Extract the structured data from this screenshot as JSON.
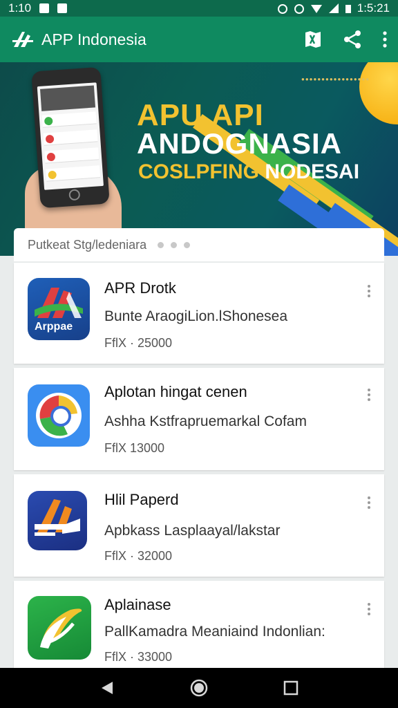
{
  "status_bar": {
    "time": "1:10",
    "clock_right": "1:5:21"
  },
  "app_bar": {
    "title": "APP Indonesia",
    "icons": [
      "logo-icon",
      "map-icon",
      "share-icon",
      "more-vert-icon"
    ]
  },
  "banner": {
    "headline_line1": "APU API",
    "headline_line2": "ANDOGNASIA",
    "headline_line3_yellow": "COSLPFING",
    "headline_line3_white": "NODESAI",
    "tagline": "●●●●●●●●●●●●●●●●●"
  },
  "search": {
    "placeholder": "Putkeat Stg/ledeniara"
  },
  "apps": [
    {
      "name": "APR Drotk",
      "description": "Bunte AraogiLion.lShonesea",
      "price": "FflX · 25000",
      "icon_label": "Arppae",
      "icon": "airpak-icon"
    },
    {
      "name": "Aplotan hingat cenen",
      "description": "Ashha Kstfrapruemarkal Cofam",
      "price": "FflX  13000",
      "icon": "browser-icon"
    },
    {
      "name": "Hlil Paperd",
      "description": "Apbkass Lasplaayal/lakstar",
      "price": "FflX · 32000",
      "icon": "paper-icon"
    },
    {
      "name": "Aplainase",
      "description": "PallKamadra Meaniaind Indonlian:",
      "price": "FflX · 33000",
      "icon": "leaf-icon"
    }
  ],
  "colors": {
    "app_bar": "#0f8a60",
    "status_bar": "#0d6a4c",
    "accent_yellow": "#f2c230"
  }
}
